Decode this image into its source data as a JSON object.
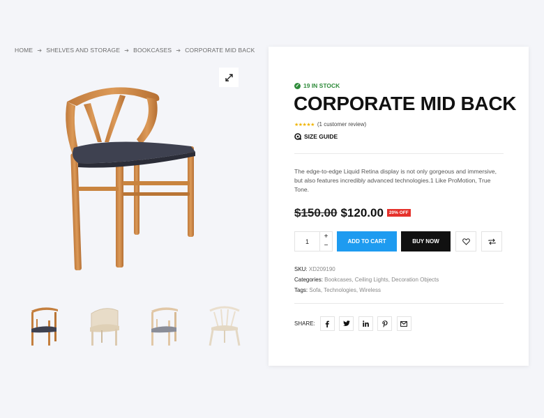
{
  "breadcrumb": [
    "HOME",
    "SHELVES AND STORAGE",
    "BOOKCASES",
    "CORPORATE MID BACK"
  ],
  "product": {
    "stock": "19 IN STOCK",
    "title": "CORPORATE MID BACK",
    "stars": "★★★★★",
    "rating_count": 5,
    "review_text": "(1 customer review)",
    "size_guide": "SIZE GUIDE",
    "description": "The edge-to-edge Liquid Retina display is not only gorgeous and immersive, but also features incredibly advanced technologies.1 Like ProMotion, True Tone.",
    "old_price": "$150.00",
    "new_price": "$120.00",
    "discount_badge": "20% OFF",
    "quantity": "1",
    "qty_plus": "+",
    "qty_minus": "−",
    "add_to_cart": "ADD TO CART",
    "buy_now": "BUY NOW",
    "sku_label": "SKU:",
    "sku_value": "XD209190",
    "categories_label": "Categories:",
    "categories": [
      "Bookcases",
      "Ceiling Lights",
      "Decoration Objects"
    ],
    "tags_label": "Tags:",
    "tags": [
      "Sofa",
      "Technologies",
      "Wireless"
    ],
    "share_label": "SHARE:"
  },
  "colors": {
    "accent": "#1e9bf0",
    "stock_green": "#2e8b3a",
    "badge_red": "#e5312b",
    "star_gold": "#f0b400",
    "buy_black": "#111111"
  },
  "icons": [
    "expand-icon",
    "check-circle-icon",
    "size-guide-icon",
    "heart-icon",
    "compare-icon",
    "facebook-icon",
    "twitter-icon",
    "linkedin-icon",
    "pinterest-icon",
    "email-icon"
  ],
  "thumbnails": [
    "wood-chair-dark-seat",
    "beige-round-chair",
    "light-wood-chair-grey-seat",
    "white-spindle-chair"
  ]
}
